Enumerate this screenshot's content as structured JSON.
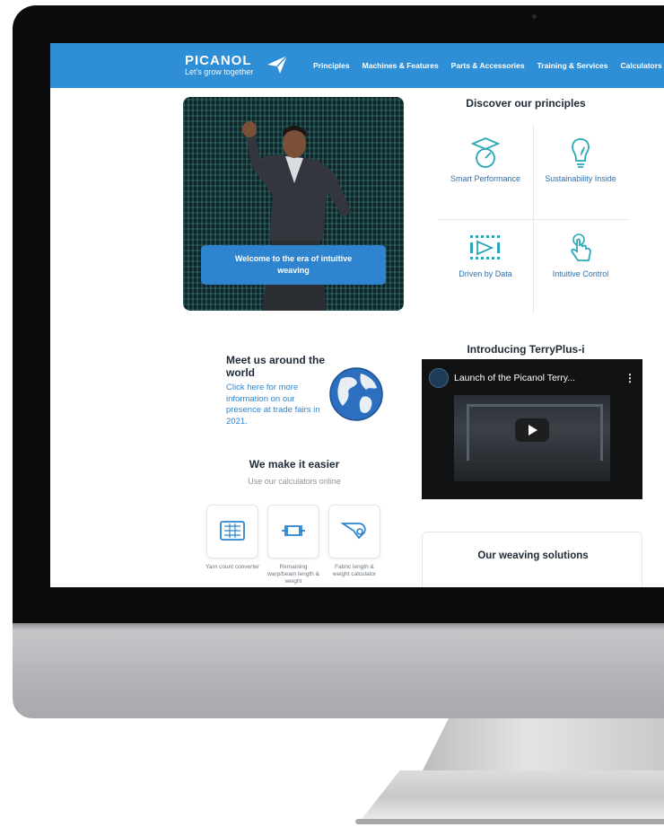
{
  "header": {
    "logo_word": "PICANOL",
    "logo_tagline": "Let's grow together",
    "nav": [
      "Principles",
      "Machines & Features",
      "Parts & Accessories",
      "Training & Services",
      "Calculators"
    ]
  },
  "hero": {
    "button_label": "Welcome to the era of intuitive weaving"
  },
  "principles": {
    "title": "Discover our principles",
    "items": [
      {
        "label": "Smart Performance",
        "icon": "graduation-gauge-icon"
      },
      {
        "label": "Sustainability Inside",
        "icon": "lightbulb-leaf-icon"
      },
      {
        "label": "Driven by Data",
        "icon": "binary-data-icon"
      },
      {
        "label": "Intuitive Control",
        "icon": "touch-hand-icon"
      }
    ]
  },
  "meet": {
    "title": "Meet us around the world",
    "text": "Click here for more information on our presence at trade fairs in 2021."
  },
  "easier": {
    "title": "We make it easier",
    "subtitle": "Use our calculators online",
    "calculators": [
      {
        "label": "Yarn count converter",
        "icon": "calculator-icon"
      },
      {
        "label": "Remaining warp/beam length & weight",
        "icon": "warp-beam-icon"
      },
      {
        "label": "Fabric length & weight calculator",
        "icon": "fabric-roll-icon"
      }
    ]
  },
  "video": {
    "title": "Introducing TerryPlus-i",
    "caption": "Launch of the Picanol Terry...",
    "menu": "⋮"
  },
  "solutions": {
    "title": "Our weaving solutions"
  },
  "colors": {
    "brand_blue": "#2f8fd6",
    "link_blue": "#2e84cf",
    "text_dark": "#1e2a38"
  }
}
